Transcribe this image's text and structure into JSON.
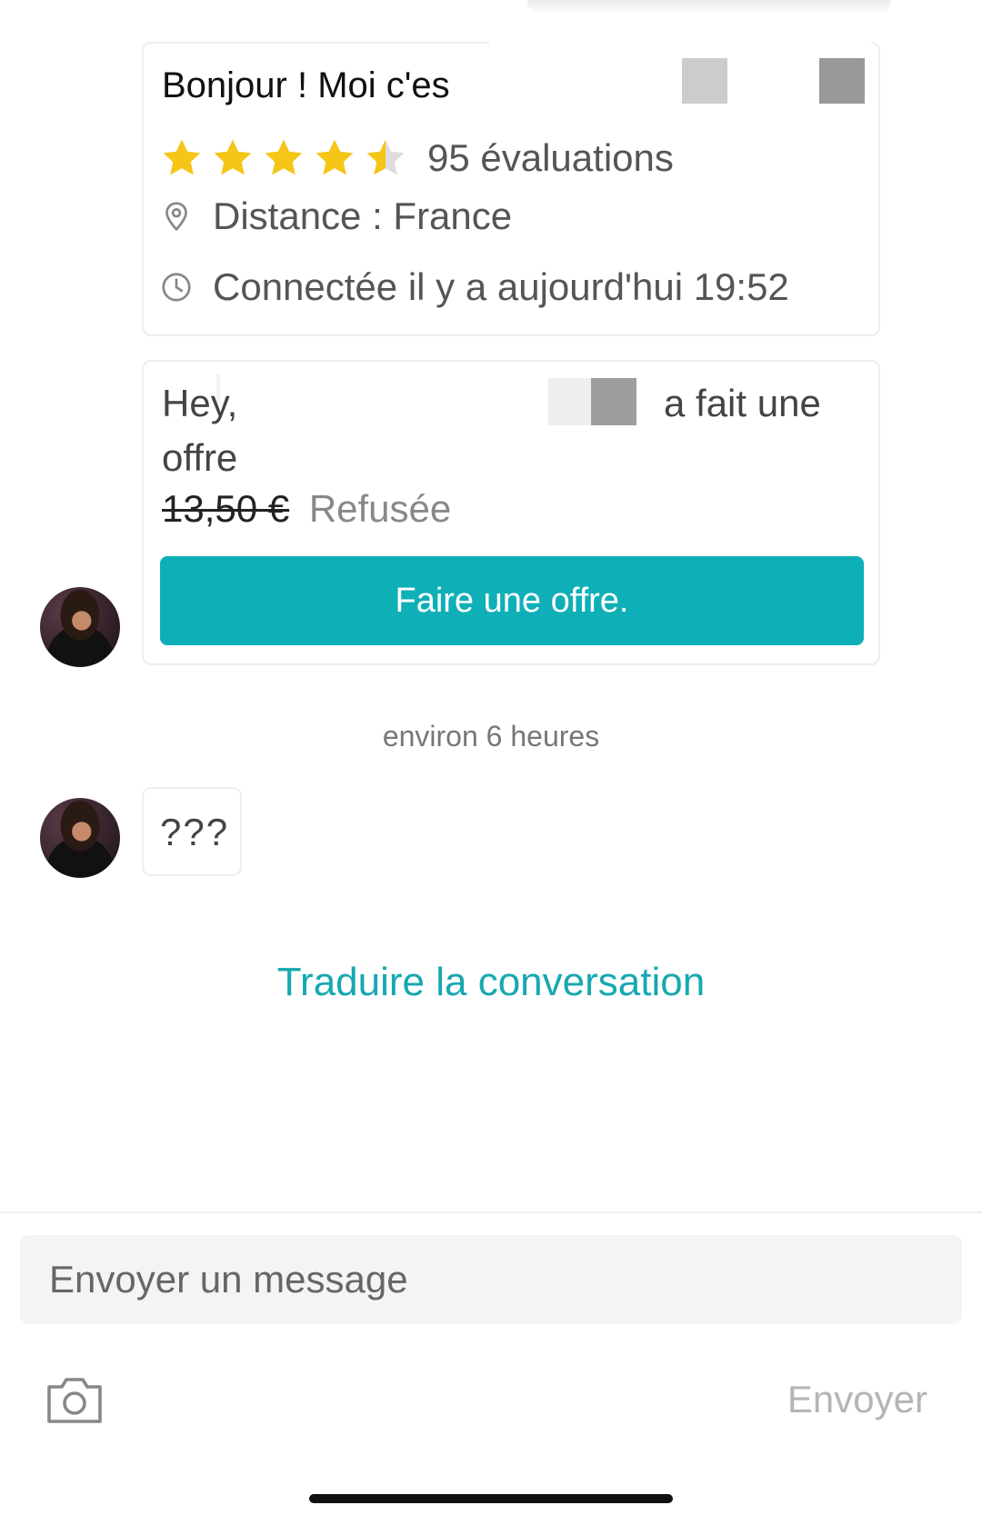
{
  "profile": {
    "greeting": "Bonjour ! Moi c'es",
    "rating": 4.5,
    "rating_max": 5,
    "reviews": "95 évaluations",
    "distance": "Distance : France",
    "last_online": "Connectée il y a aujourd'hui 19:52"
  },
  "offer": {
    "line1_start": "Hey,",
    "line1_end": "a fait une",
    "line2": "offre",
    "price": "13,50 €",
    "status": "Refusée",
    "button_label": "Faire une offre."
  },
  "timestamp": "environ 6 heures",
  "message": {
    "text": "???"
  },
  "translate_link": "Traduire la conversation",
  "composer": {
    "placeholder": "Envoyer un message",
    "send_label": "Envoyer",
    "camera_icon": "camera-icon"
  },
  "colors": {
    "accent": "#0fafb8",
    "link": "#17a8b0",
    "star": "#f5c518",
    "star_empty": "#dddddd"
  }
}
